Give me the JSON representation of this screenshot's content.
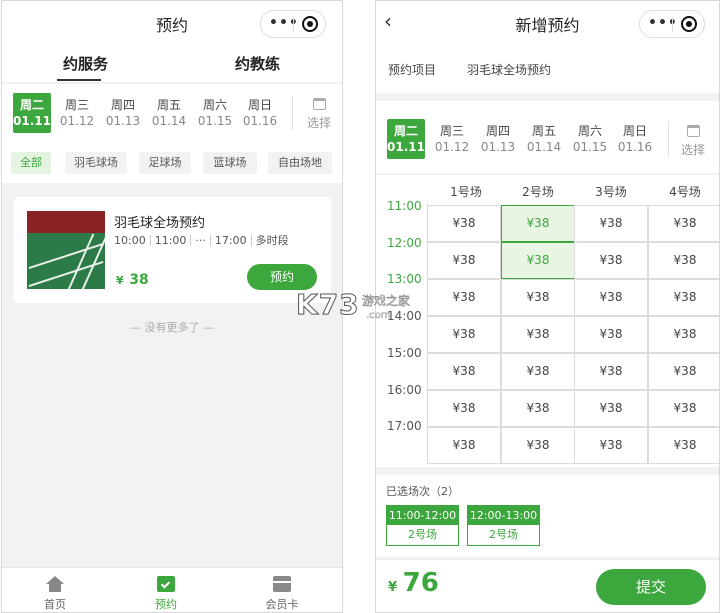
{
  "left": {
    "nav_title": "预约",
    "more_icon": "•••",
    "tabs": [
      "约服务",
      "约教练"
    ],
    "dates": [
      {
        "week": "周二",
        "date": "01.11"
      },
      {
        "week": "周三",
        "date": "01.12"
      },
      {
        "week": "周四",
        "date": "01.13"
      },
      {
        "week": "周五",
        "date": "01.14"
      },
      {
        "week": "周六",
        "date": "01.15"
      },
      {
        "week": "周日",
        "date": "01.16"
      }
    ],
    "select_label": "选择",
    "filters": [
      "全部",
      "羽毛球场",
      "足球场",
      "篮球场",
      "自由场地"
    ],
    "card": {
      "title": "羽毛球全场预约",
      "times": [
        "10:00",
        "11:00",
        "···",
        "17:00",
        "多时段"
      ],
      "currency": "¥",
      "price": "38",
      "book_label": "预约"
    },
    "no_more": "— 没有更多了 —",
    "tabbar": [
      "首页",
      "预约",
      "会员卡"
    ]
  },
  "right": {
    "nav_title": "新增预约",
    "back_icon": "‹",
    "more_icon": "•••",
    "project_label": "预约项目",
    "project_value": "羽毛球全场预约",
    "dates": [
      {
        "week": "周二",
        "date": "01.11"
      },
      {
        "week": "周三",
        "date": "01.12"
      },
      {
        "week": "周四",
        "date": "01.13"
      },
      {
        "week": "周五",
        "date": "01.14"
      },
      {
        "week": "周六",
        "date": "01.15"
      },
      {
        "week": "周日",
        "date": "01.16"
      }
    ],
    "select_label": "选择",
    "courts": [
      "1号场",
      "2号场",
      "3号场",
      "4号场"
    ],
    "times": [
      "11:00",
      "12:00",
      "13:00",
      "14:00",
      "15:00",
      "16:00",
      "17:00"
    ],
    "cell_price": "¥38",
    "selected_cells": [
      [
        0,
        1
      ],
      [
        1,
        1
      ]
    ],
    "selected_label": "已选场次（2）",
    "selected_slots": [
      {
        "time": "11:00-12:00",
        "court": "2号场"
      },
      {
        "time": "12:00-13:00",
        "court": "2号场"
      }
    ],
    "currency": "¥",
    "total": "76",
    "submit_label": "提交"
  },
  "watermark": {
    "logo": "K73",
    "cn": "游戏之家",
    "domain": ".com"
  },
  "colors": {
    "accent": "#3ca73c",
    "selected_bg": "#e8f5e3"
  }
}
